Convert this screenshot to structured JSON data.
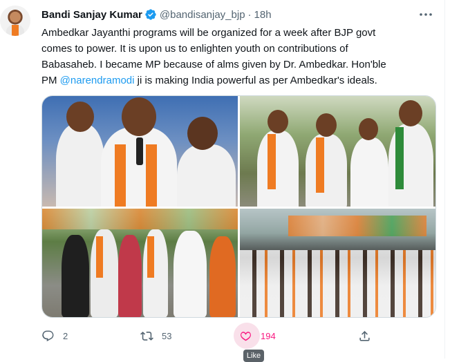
{
  "tweet": {
    "author_name": "Bandi Sanjay Kumar",
    "handle": "@bandisanjay_bjp",
    "separator": "·",
    "time": "18h",
    "text_line1": "Ambedkar Jayanthi programs will be organized for a week after BJP govt",
    "text_line2": "comes to power. It is upon us to enlighten youth on contributions of",
    "text_line3": "Babasaheb. I became MP because of alms given by Dr. Ambedkar. Hon'ble",
    "text_line4_pre": "PM ",
    "mention": "@narendramodi",
    "text_line4_post": " ji is making India powerful as per Ambedkar's ideals."
  },
  "actions": {
    "replies": "2",
    "retweets": "53",
    "likes": "194",
    "like_tooltip": "Like"
  },
  "colors": {
    "accent": "#1d9bf0",
    "like": "#f91880",
    "secondary_text": "#536471",
    "saffron": "#ef7b22"
  },
  "icons": [
    "verified-badge-icon",
    "more-icon",
    "reply-icon",
    "retweet-icon",
    "like-heart-icon",
    "share-icon"
  ]
}
